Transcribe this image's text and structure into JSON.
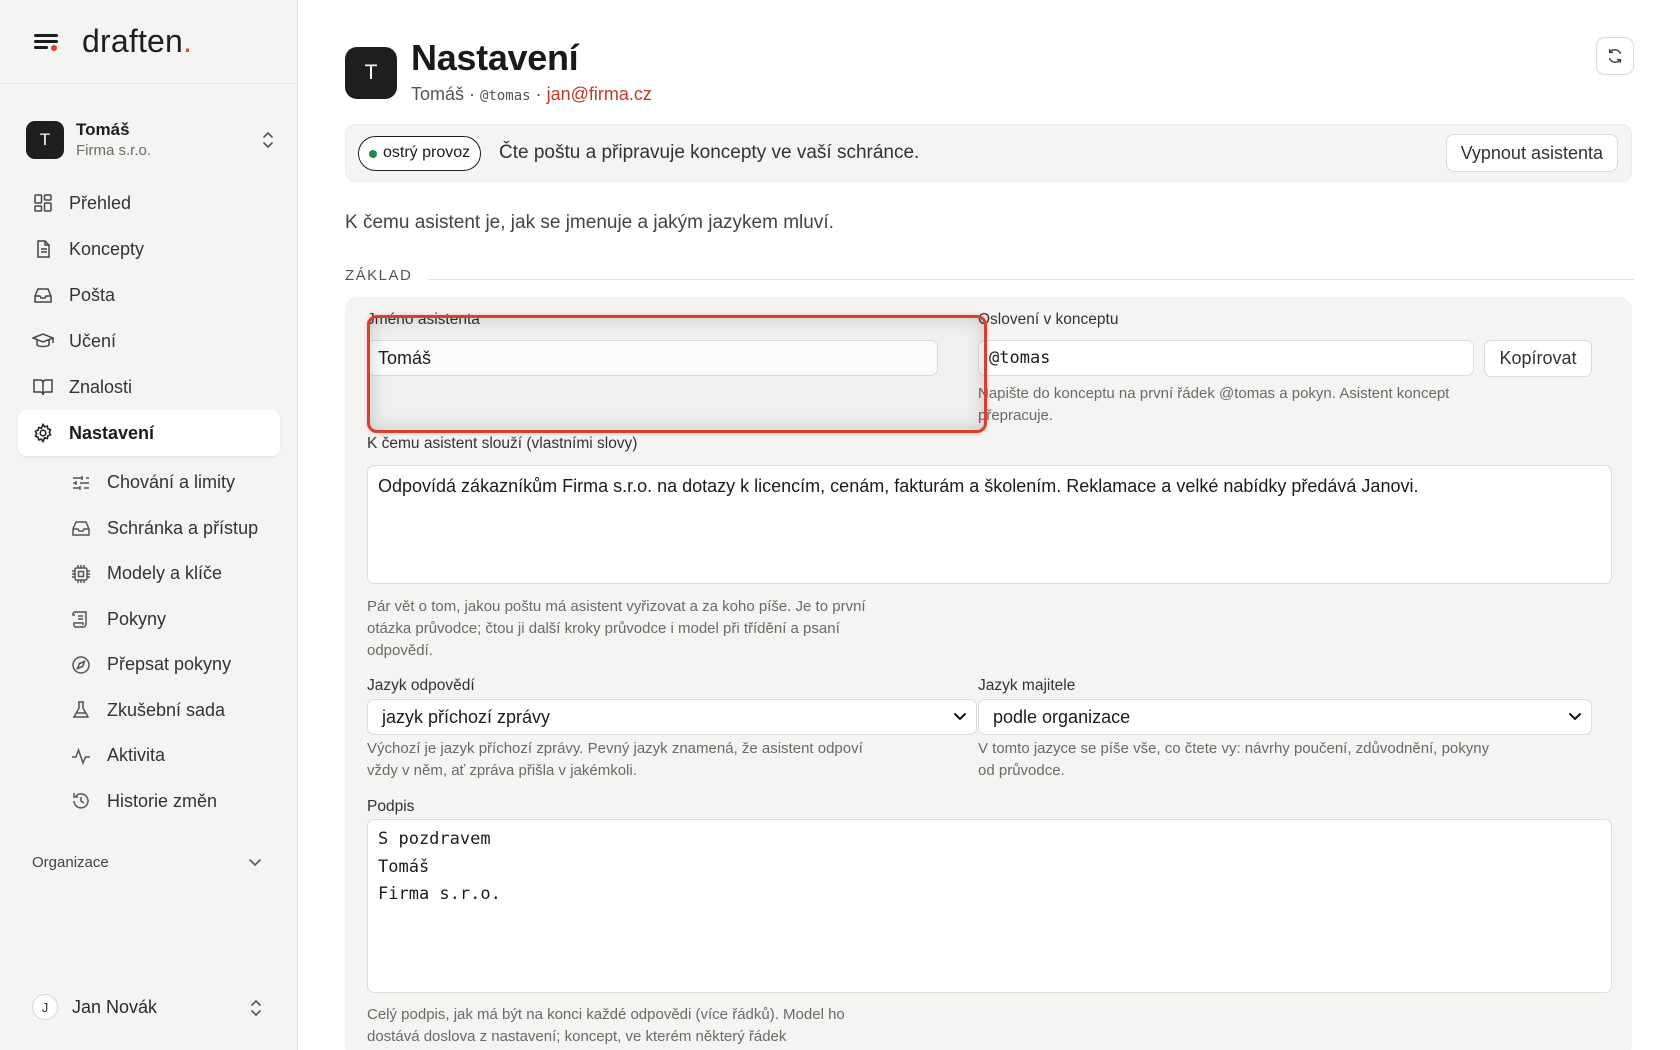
{
  "brand": {
    "logo_text": "draften",
    "logo_dot": "."
  },
  "workspace": {
    "avatar": "T",
    "name": "Tomáš",
    "org": "Firma s.r.o."
  },
  "nav": {
    "items": [
      {
        "label": "Přehled",
        "icon": "dashboard-icon"
      },
      {
        "label": "Koncepty",
        "icon": "document-icon"
      },
      {
        "label": "Pošta",
        "icon": "inbox-icon"
      },
      {
        "label": "Učení",
        "icon": "graduation-cap-icon"
      },
      {
        "label": "Znalosti",
        "icon": "book-icon"
      },
      {
        "label": "Nastavení",
        "icon": "gear-icon",
        "active": true
      }
    ],
    "subitems": [
      {
        "label": "Chování a limity",
        "icon": "sliders-icon"
      },
      {
        "label": "Schránka a přístup",
        "icon": "inbox-icon"
      },
      {
        "label": "Modely a klíče",
        "icon": "chip-icon"
      },
      {
        "label": "Pokyny",
        "icon": "scroll-icon"
      },
      {
        "label": "Přepsat pokyny",
        "icon": "compass-icon"
      },
      {
        "label": "Zkušební sada",
        "icon": "flask-icon"
      },
      {
        "label": "Aktivita",
        "icon": "activity-icon"
      },
      {
        "label": "Historie změn",
        "icon": "history-icon"
      }
    ],
    "org_label": "Organizace"
  },
  "user": {
    "avatar": "J",
    "name": "Jan Novák"
  },
  "header": {
    "avatar": "T",
    "title": "Nastavení",
    "name": "Tomáš",
    "sep1": " · ",
    "handle": "@tomas",
    "sep2": " · ",
    "email": "jan@firma.cz"
  },
  "banner": {
    "status": "ostrý provoz",
    "text": "Čte poštu a připravuje koncepty ve vaší schránce.",
    "button": "Vypnout asistenta"
  },
  "intro": "K čemu asistent je, jak se jmenuje a jakým jazykem mluví.",
  "section": "ZÁKLAD",
  "form": {
    "name_label": "Jméno asistenta",
    "name_value": "Tomáš",
    "greeting_label": "Oslovení v konceptu",
    "greeting_value": "@tomas",
    "copy_button": "Kopírovat",
    "greeting_help": "Napište do konceptu na první řádek @tomas a pokyn. Asistent koncept přepracuje.",
    "purpose_label": "K čemu asistent slouží (vlastními slovy)",
    "purpose_value": "Odpovídá zákazníkům Firma s.r.o. na dotazy k licencím, cenám, fakturám a školením. Reklamace a velké nabídky předává Janovi.",
    "purpose_help": "Pár vět o tom, jakou poštu má asistent vyřizovat a za koho píše. Je to první otázka průvodce; čtou ji další kroky průvodce i model při třídění a psaní odpovědí.",
    "reply_lang_label": "Jazyk odpovědí",
    "reply_lang_value": "jazyk příchozí zprávy",
    "reply_lang_help": "Výchozí je jazyk příchozí zprávy. Pevný jazyk znamená, že asistent odpoví vždy v něm, ať zpráva přišla v jakémkoli.",
    "owner_lang_label": "Jazyk majitele",
    "owner_lang_value": "podle organizace",
    "owner_lang_help": "V tomto jazyce se píše vše, co čtete vy: návrhy poučení, zdůvodnění, pokyny od průvodce.",
    "signature_label": "Podpis",
    "signature_value": "S pozdravem\nTomáš\nFirma s.r.o.",
    "signature_help": "Celý podpis, jak má být na konci každé odpovědi (více řádků). Model ho dostává doslova z nastavení; koncept, ve kterém některý řádek"
  },
  "colors": {
    "accent": "#d9442a",
    "live": "#1f8a4c",
    "email": "#c0392b",
    "sidebar_bg": "#f4f4f3"
  }
}
